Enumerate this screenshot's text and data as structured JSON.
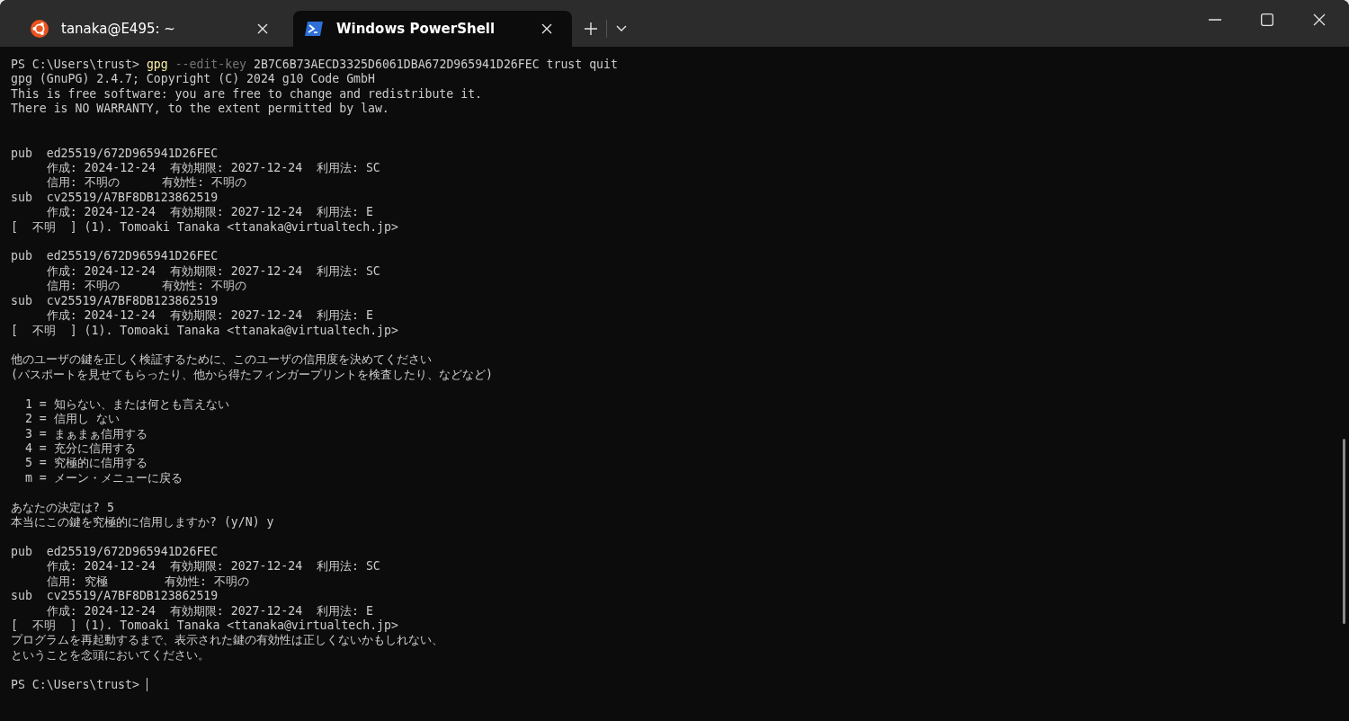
{
  "tabs": [
    {
      "title": "tanaka@E495: ~",
      "kind": "ubuntu",
      "selected": false
    },
    {
      "title": "Windows PowerShell",
      "kind": "powershell",
      "selected": true
    }
  ],
  "terminal": {
    "lines": [
      {
        "kind": "command",
        "segments": [
          {
            "text": "PS C:\\Users\\trust>",
            "kind": "prompt"
          },
          {
            "text": "gpg",
            "kind": "program"
          },
          {
            "text": "--edit-key",
            "kind": "option"
          },
          {
            "text": "2B7C6B73AECD3325D6061DBA672D965941D26FEC trust quit",
            "kind": "argument"
          }
        ]
      },
      {
        "kind": "text",
        "text": "gpg (GnuPG) 2.4.7; Copyright (C) 2024 g10 Code GmbH"
      },
      {
        "kind": "text",
        "text": "This is free software: you are free to change and redistribute it."
      },
      {
        "kind": "text",
        "text": "There is NO WARRANTY, to the extent permitted by law."
      },
      {
        "kind": "blank"
      },
      {
        "kind": "blank"
      },
      {
        "kind": "text",
        "text": "pub  ed25519/672D965941D26FEC"
      },
      {
        "kind": "text",
        "text": "     作成: 2024-12-24  有効期限: 2027-12-24  利用法: SC"
      },
      {
        "kind": "text",
        "text": "     信用: 不明の      有効性: 不明の"
      },
      {
        "kind": "text",
        "text": "sub  cv25519/A7BF8DB123862519"
      },
      {
        "kind": "text",
        "text": "     作成: 2024-12-24  有効期限: 2027-12-24  利用法: E"
      },
      {
        "kind": "text",
        "text": "[  不明  ] (1). Tomoaki Tanaka <ttanaka@virtualtech.jp>"
      },
      {
        "kind": "blank"
      },
      {
        "kind": "text",
        "text": "pub  ed25519/672D965941D26FEC"
      },
      {
        "kind": "text",
        "text": "     作成: 2024-12-24  有効期限: 2027-12-24  利用法: SC"
      },
      {
        "kind": "text",
        "text": "     信用: 不明の      有効性: 不明の"
      },
      {
        "kind": "text",
        "text": "sub  cv25519/A7BF8DB123862519"
      },
      {
        "kind": "text",
        "text": "     作成: 2024-12-24  有効期限: 2027-12-24  利用法: E"
      },
      {
        "kind": "text",
        "text": "[  不明  ] (1). Tomoaki Tanaka <ttanaka@virtualtech.jp>"
      },
      {
        "kind": "blank"
      },
      {
        "kind": "text",
        "text": "他のユーザの鍵を正しく検証するために、このユーザの信用度を決めてください"
      },
      {
        "kind": "text",
        "text": "(パスポートを見せてもらったり、他から得たフィンガープリントを検査したり、などなど)"
      },
      {
        "kind": "blank"
      },
      {
        "kind": "text",
        "text": "  1 = 知らない、または何とも言えない"
      },
      {
        "kind": "text",
        "text": "  2 = 信用し ない"
      },
      {
        "kind": "text",
        "text": "  3 = まぁまぁ信用する"
      },
      {
        "kind": "text",
        "text": "  4 = 充分に信用する"
      },
      {
        "kind": "text",
        "text": "  5 = 究極的に信用する"
      },
      {
        "kind": "text",
        "text": "  m = メーン・メニューに戻る"
      },
      {
        "kind": "blank"
      },
      {
        "kind": "text",
        "text": "あなたの決定は? 5"
      },
      {
        "kind": "text",
        "text": "本当にこの鍵を究極的に信用しますか? (y/N) y"
      },
      {
        "kind": "blank"
      },
      {
        "kind": "text",
        "text": "pub  ed25519/672D965941D26FEC"
      },
      {
        "kind": "text",
        "text": "     作成: 2024-12-24  有効期限: 2027-12-24  利用法: SC"
      },
      {
        "kind": "text",
        "text": "     信用: 究極        有効性: 不明の"
      },
      {
        "kind": "text",
        "text": "sub  cv25519/A7BF8DB123862519"
      },
      {
        "kind": "text",
        "text": "     作成: 2024-12-24  有効期限: 2027-12-24  利用法: E"
      },
      {
        "kind": "text",
        "text": "[  不明  ] (1). Tomoaki Tanaka <ttanaka@virtualtech.jp>"
      },
      {
        "kind": "text",
        "text": "プログラムを再起動するまで、表示された鍵の有効性は正しくないかもしれない、"
      },
      {
        "kind": "text",
        "text": "ということを念頭においてください。"
      },
      {
        "kind": "blank"
      },
      {
        "kind": "prompt",
        "text": "PS C:\\Users\\trust>"
      }
    ]
  }
}
